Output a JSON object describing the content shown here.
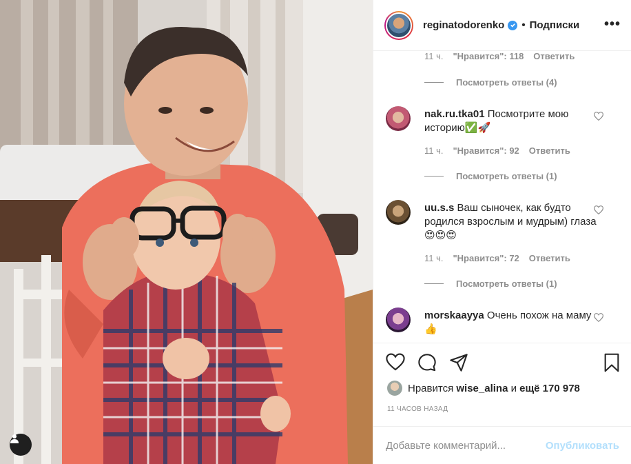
{
  "post": {
    "username": "reginatodorenko",
    "follow_label": "Подписки",
    "dot": "•",
    "more": "•••"
  },
  "comments_area": {
    "top_meta": {
      "time": "11 ч.",
      "likes": "\"Нравится\": 118",
      "reply": "Ответить"
    },
    "view_replies_1": "Посмотреть ответы (4)",
    "items": [
      {
        "username": "nak.ru.tka01",
        "text": "Посмотрите мою историю✅🚀",
        "time": "11 ч.",
        "likes": "\"Нравится\": 92",
        "reply": "Ответить",
        "view_replies": "Посмотреть ответы (1)"
      },
      {
        "username": "uu.s.s",
        "text": "Ваш сыночек, как будто родился взрослым и мудрым) глаза😍😍😍",
        "time": "11 ч.",
        "likes": "\"Нравится\": 72",
        "reply": "Ответить",
        "view_replies": "Посмотреть ответы (1)"
      },
      {
        "username": "morskaayya",
        "text": "Очень похож на маму👍"
      }
    ]
  },
  "likes": {
    "prefix": "Нравится",
    "user": "wise_alina",
    "middle": "и",
    "count": "ещё 170 978"
  },
  "time_ago": "11 ЧАСОВ НАЗАД",
  "add_comment": {
    "placeholder": "Добавьте комментарий...",
    "publish": "Опубликовать"
  },
  "colors": {
    "verified": "#3897f0",
    "publish_disabled": "#b2dffc",
    "muted": "#8e8e8e"
  }
}
